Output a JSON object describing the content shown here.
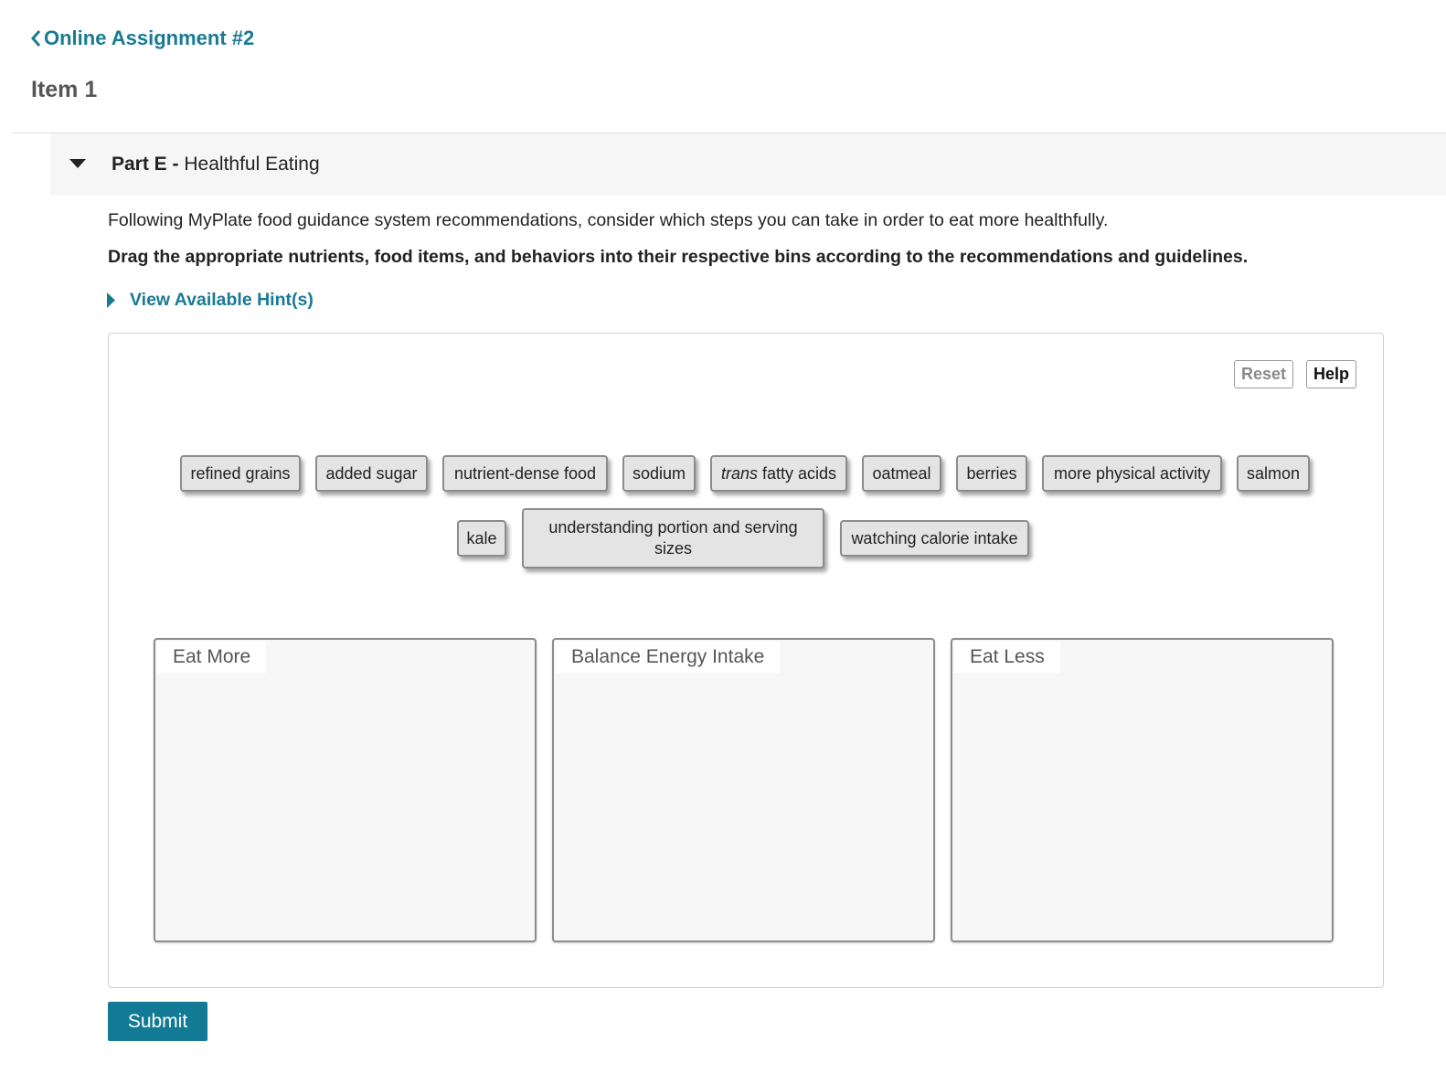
{
  "nav": {
    "back_label": "Online Assignment #2"
  },
  "item": {
    "title": "Item 1"
  },
  "part": {
    "prefix": "Part E -",
    "title": "Healthful Eating"
  },
  "question": {
    "instructions": "Following MyPlate food guidance system recommendations, consider which steps you can take in order to eat more healthfully.",
    "task": "Drag the appropriate nutrients, food items, and behaviors into their respective bins according to the recommendations and guidelines."
  },
  "hints": {
    "label": "View Available Hint(s)"
  },
  "toolbar": {
    "reset_label": "Reset",
    "help_label": "Help"
  },
  "tiles": {
    "refined_grains": "refined grains",
    "added_sugar": "added sugar",
    "nutrient_dense_food": "nutrient-dense food",
    "sodium": "sodium",
    "trans_fatty_acids_italic": "trans",
    "trans_fatty_acids_rest": "fatty acids",
    "oatmeal": "oatmeal",
    "berries": "berries",
    "more_physical_activity": "more physical activity",
    "salmon": "salmon",
    "kale": "kale",
    "understanding_portion": "understanding portion and serving sizes",
    "watching_calorie_intake": "watching calorie intake"
  },
  "bins": {
    "eat_more": "Eat More",
    "balance_energy": "Balance Energy Intake",
    "eat_less": "Eat Less"
  },
  "submit": {
    "label": "Submit"
  },
  "colors": {
    "accent": "#1a7a93",
    "submit_bg": "#127a94",
    "tile_bg": "#e4e4e4"
  },
  "icons": {
    "back": "chevron-left-icon",
    "part_toggle": "caret-down-icon",
    "hint_toggle": "caret-right-icon"
  }
}
